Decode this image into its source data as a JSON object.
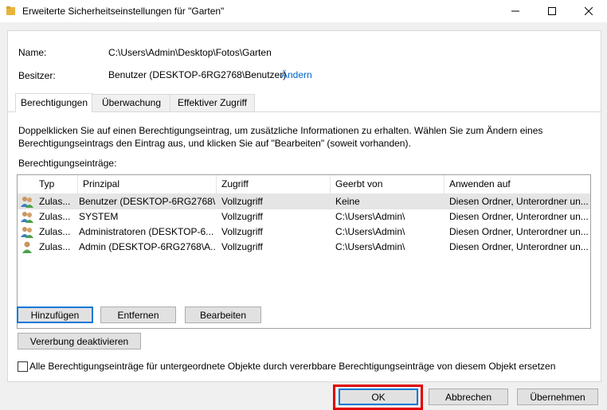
{
  "window": {
    "title": "Erweiterte Sicherheitseinstellungen für \"Garten\""
  },
  "info": {
    "name_label": "Name:",
    "name_value": "C:\\Users\\Admin\\Desktop\\Fotos\\Garten",
    "owner_label": "Besitzer:",
    "owner_value": "Benutzer (DESKTOP-6RG2768\\Benutzer)",
    "owner_change_link": "Ändern"
  },
  "tabs": [
    {
      "label": "Berechtigungen",
      "active": true
    },
    {
      "label": "Überwachung",
      "active": false
    },
    {
      "label": "Effektiver Zugriff",
      "active": false
    }
  ],
  "description": "Doppelklicken Sie auf einen Berechtigungseintrag, um zusätzliche Informationen zu erhalten. Wählen Sie zum Ändern eines Berechtigungseintrags den Eintrag aus, und klicken Sie auf \"Bearbeiten\" (soweit vorhanden).",
  "entries_label": "Berechtigungseinträge:",
  "table": {
    "columns": [
      "Typ",
      "Prinzipal",
      "Zugriff",
      "Geerbt von",
      "Anwenden auf"
    ],
    "rows": [
      {
        "type": "Zulas...",
        "principal": "Benutzer (DESKTOP-6RG2768\\...",
        "access": "Vollzugriff",
        "inherited": "Keine",
        "applies": "Diesen Ordner, Unterordner un...",
        "icon": "users-group-icon"
      },
      {
        "type": "Zulas...",
        "principal": "SYSTEM",
        "access": "Vollzugriff",
        "inherited": "C:\\Users\\Admin\\",
        "applies": "Diesen Ordner, Unterordner un...",
        "icon": "users-group-icon"
      },
      {
        "type": "Zulas...",
        "principal": "Administratoren (DESKTOP-6...",
        "access": "Vollzugriff",
        "inherited": "C:\\Users\\Admin\\",
        "applies": "Diesen Ordner, Unterordner un...",
        "icon": "users-group-icon"
      },
      {
        "type": "Zulas...",
        "principal": "Admin (DESKTOP-6RG2768\\A...",
        "access": "Vollzugriff",
        "inherited": "C:\\Users\\Admin\\",
        "applies": "Diesen Ordner, Unterordner un...",
        "icon": "user-icon"
      }
    ]
  },
  "buttons": {
    "add": "Hinzufügen",
    "remove": "Entfernen",
    "edit": "Bearbeiten",
    "disable_inheritance": "Vererbung deaktivieren",
    "ok": "OK",
    "cancel": "Abbrechen",
    "apply": "Übernehmen"
  },
  "replace_checkbox": {
    "label": "Alle Berechtigungseinträge für untergeordnete Objekte durch vererbbare Berechtigungseinträge von diesem Objekt ersetzen",
    "checked": false
  },
  "colors": {
    "link": "#0066cc",
    "highlight": "#e00000",
    "focus": "#0078d7"
  }
}
